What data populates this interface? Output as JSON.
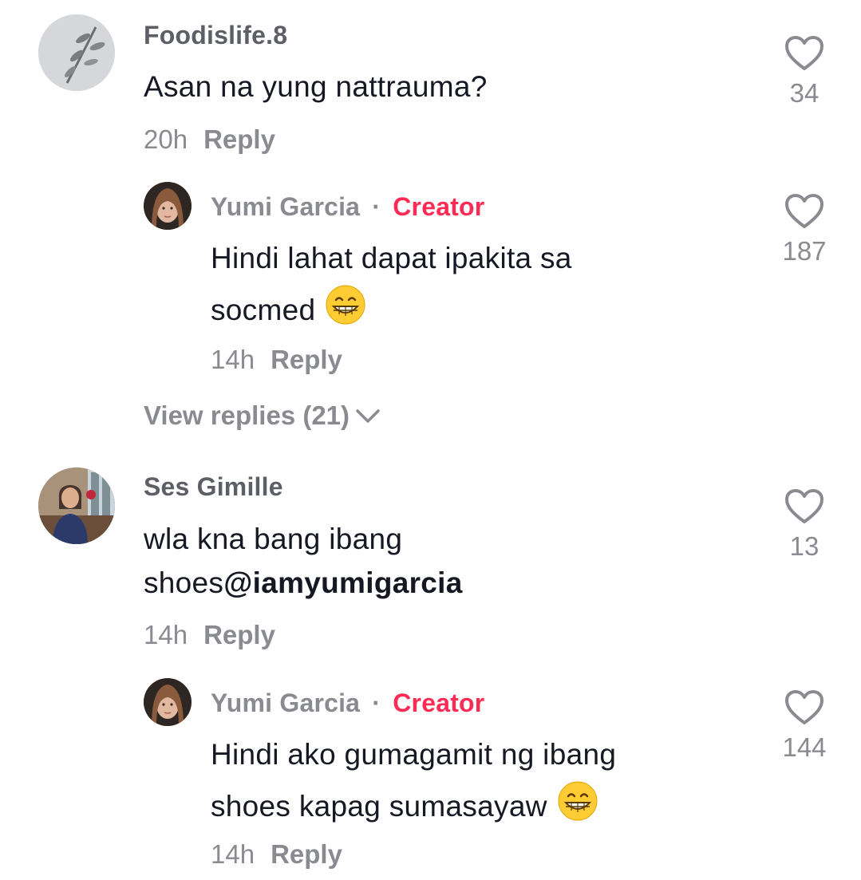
{
  "comments": [
    {
      "username": "Foodislife.8",
      "text": "Asan na yung nattrauma?",
      "time": "20h",
      "reply_label": "Reply",
      "likes": "34",
      "avatar_icon": "leaf-drawing-avatar",
      "replies": [
        {
          "username": "Yumi Garcia",
          "separator": "·",
          "badge": "Creator",
          "text_line1": "Hindi lahat dapat ipakita sa",
          "text_line2": "socmed",
          "emoji": "grinning-face-icon",
          "time": "14h",
          "reply_label": "Reply",
          "likes": "187"
        }
      ],
      "view_replies": "View replies (21)"
    },
    {
      "username": "Ses Gimille",
      "text_line1": "wla kna bang ibang",
      "text_line2_prefix": "shoes",
      "mention": "@iamyumigarcia",
      "time": "14h",
      "reply_label": "Reply",
      "likes": "13",
      "avatar_icon": "woman-photo-avatar",
      "replies": [
        {
          "username": "Yumi Garcia",
          "separator": "·",
          "badge": "Creator",
          "text_line1": "Hindi ako gumagamit ng ibang",
          "text_line2": "shoes kapag sumasayaw",
          "emoji": "grinning-face-icon",
          "time": "14h",
          "reply_label": "Reply",
          "likes": "144"
        }
      ]
    }
  ],
  "colors": {
    "creator_badge": "#fe2c55",
    "secondary_text": "#8a8b91",
    "primary_text": "#161823"
  }
}
